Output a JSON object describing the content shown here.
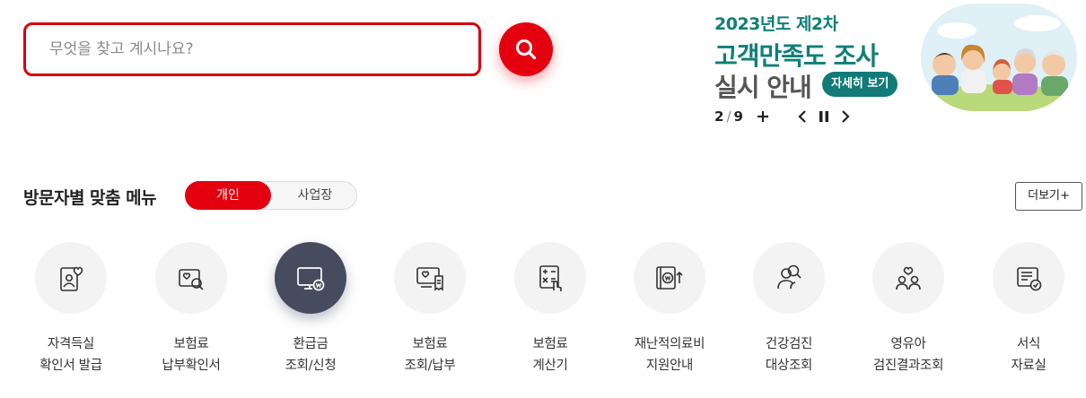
{
  "search": {
    "placeholder": "무엇을 찾고 계시나요?",
    "icon": "search-icon"
  },
  "banner": {
    "line1": "2023년도 제2차",
    "line2": "고객만족도 조사",
    "line3": "실시 안내",
    "detail_label": "자세히 보기",
    "current": "2",
    "total": "9",
    "brand_color": "#0e7f77"
  },
  "menu": {
    "title": "방문자별 맞춤 메뉴",
    "toggle": {
      "selected": "개인",
      "other": "사업장"
    },
    "more_label": "더보기+",
    "items": [
      {
        "line1": "자격득실",
        "line2": "확인서 발급",
        "icon": "id-card-heart-icon"
      },
      {
        "line1": "보험료",
        "line2": "납부확인서",
        "icon": "document-search-icon"
      },
      {
        "line1": "환급금",
        "line2": "조회/신청",
        "icon": "monitor-won-icon"
      },
      {
        "line1": "보험료",
        "line2": "조회/납부",
        "icon": "monitor-receipt-icon"
      },
      {
        "line1": "보험료",
        "line2": "계산기",
        "icon": "calculator-icon"
      },
      {
        "line1": "재난적의료비",
        "line2": "지원안내",
        "icon": "book-won-icon"
      },
      {
        "line1": "건강검진",
        "line2": "대상조회",
        "icon": "person-search-icon"
      },
      {
        "line1": "영유아",
        "line2": "검진결과조회",
        "icon": "family-heart-icon"
      },
      {
        "line1": "서식",
        "line2": "자료실",
        "icon": "document-check-icon"
      }
    ]
  },
  "colors": {
    "accent": "#e5000f",
    "active_icon_bg": "#464b5e",
    "icon_bg": "#f3f3f3"
  }
}
